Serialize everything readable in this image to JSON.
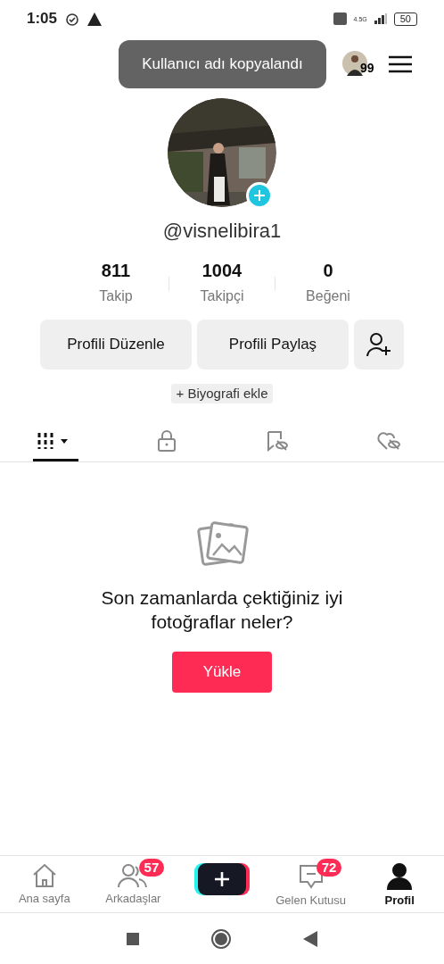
{
  "status_bar": {
    "time": "1:05",
    "network": "4.5G",
    "battery": "50"
  },
  "header": {
    "toast": "Kullanıcı adı kopyalandı",
    "story_count": "99"
  },
  "profile": {
    "username": "@visnelibira1",
    "stats": [
      {
        "value": "811",
        "label": "Takip"
      },
      {
        "value": "1004",
        "label": "Takipçi"
      },
      {
        "value": "0",
        "label": "Beğeni"
      }
    ],
    "buttons": [
      "Profili Düzenle",
      "Profili Paylaş"
    ],
    "bio_tag": "+ Biyografi ekle"
  },
  "tabs": [
    {
      "kind": "grid",
      "selected": true
    },
    {
      "kind": "lock",
      "selected": false
    },
    {
      "kind": "bookmark",
      "selected": false
    },
    {
      "kind": "heart",
      "selected": false
    }
  ],
  "empty_state": {
    "message": "Son zamanlarda çektiğiniz iyi fotoğraflar neler?",
    "button": "Yükle"
  },
  "bottom_nav": [
    {
      "kind": "home",
      "label": "Ana sayfa",
      "selected": false
    },
    {
      "kind": "friends",
      "label": "Arkadaşlar",
      "badge": "57",
      "selected": false
    },
    {
      "kind": "create"
    },
    {
      "kind": "inbox",
      "label": "Gelen Kutusu",
      "badge": "72",
      "selected": false
    },
    {
      "kind": "profile",
      "label": "Profil",
      "selected": true
    }
  ]
}
